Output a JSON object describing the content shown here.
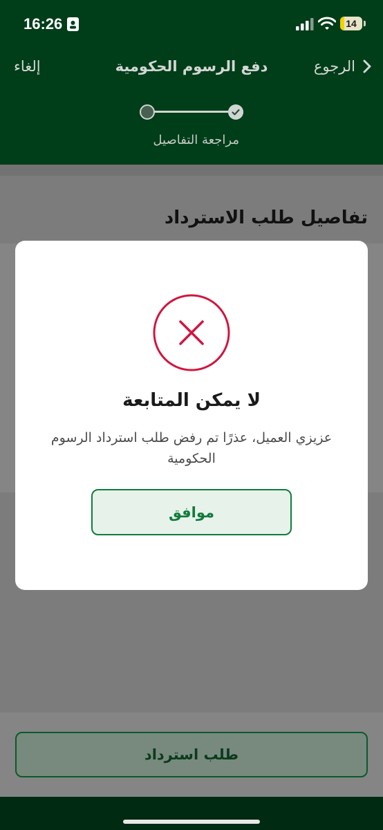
{
  "status_bar": {
    "time": "16:26",
    "battery": "14",
    "icons": [
      "id-card-icon",
      "signal-icon",
      "wifi-icon",
      "battery-icon"
    ]
  },
  "header": {
    "cancel_label": "إلغاء",
    "title": "دفع الرسوم الحكومية",
    "back_label": "الرجوع",
    "back_icon": "chevron-right-icon",
    "step_label": "مراجعة التفاصيل"
  },
  "page": {
    "section_title": "تفاصيل طلب الاسترداد",
    "refund_button_label": "طلب استرداد"
  },
  "modal": {
    "icon": "error-x-icon",
    "title": "لا يمكن المتابعة",
    "message": "عزيزي العميل، عذرًا تم رفض طلب استرداد الرسوم الحكومية",
    "ok_label": "موافق"
  },
  "colors": {
    "brand_green": "#004d20",
    "accent_green": "#137a3c",
    "error_red": "#d0163f",
    "overlay": "#7c7c7c"
  }
}
